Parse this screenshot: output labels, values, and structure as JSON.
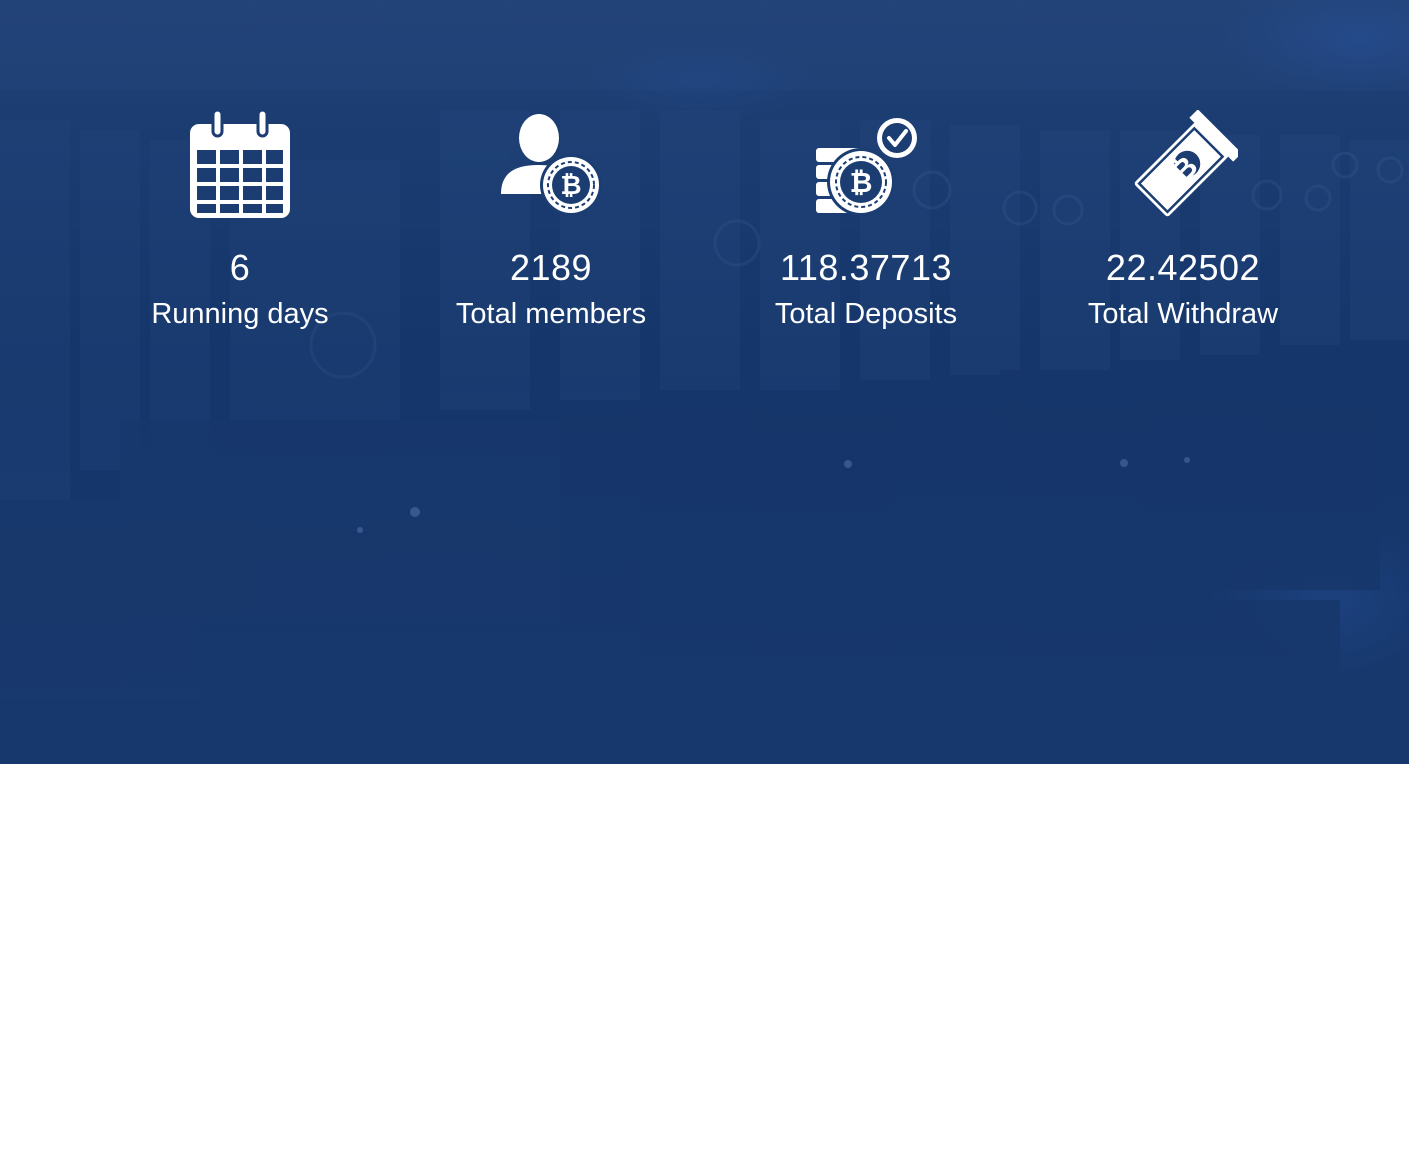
{
  "colors": {
    "hero_tint": "#15356a",
    "text": "#ffffff",
    "icon_fill": "#ffffff",
    "icon_detail": "#1b3d72",
    "page_background": "#ffffff"
  },
  "background": {
    "description_icon": "bitcoin-mining-rig-icon"
  },
  "stats": [
    {
      "icon": "calendar-icon",
      "value": "6",
      "label": "Running days"
    },
    {
      "icon": "user-bitcoin-icon",
      "value": "2189",
      "label": "Total members"
    },
    {
      "icon": "coin-stack-check-icon",
      "value": "118.37713",
      "label": "Total Deposits"
    },
    {
      "icon": "bitcoin-ticket-icon",
      "value": "22.42502",
      "label": "Total Withdraw"
    }
  ]
}
